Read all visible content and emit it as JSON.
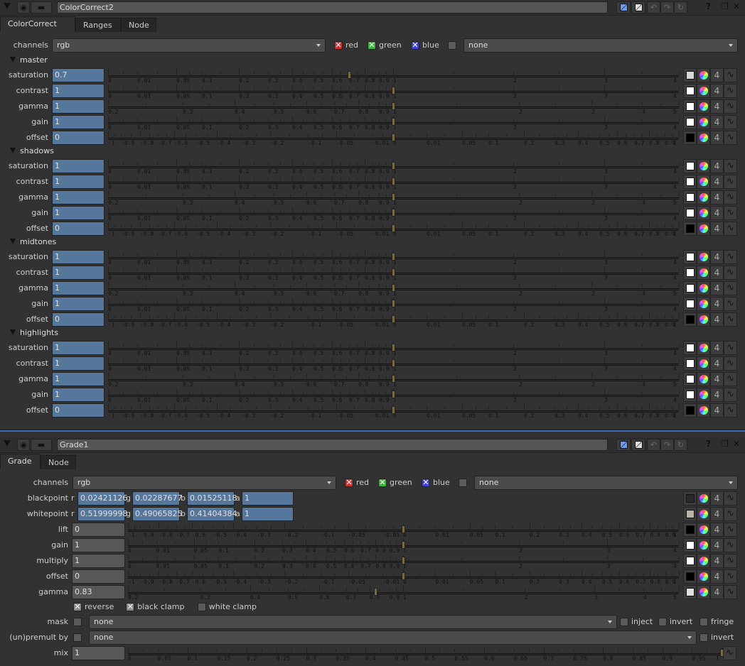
{
  "panel1": {
    "title": "ColorCorrect2",
    "tabs": [
      "ColorCorrect",
      "Ranges",
      "Node"
    ],
    "channels_label": "channels",
    "channels_value": "rgb",
    "red": "red",
    "green": "green",
    "blue": "blue",
    "extra_channel": "none",
    "sections": [
      {
        "name": "master",
        "rows": [
          {
            "label": "saturation",
            "value": "0.7",
            "scale": "lin4",
            "swatch": "#d8d8d8"
          },
          {
            "label": "contrast",
            "value": "1",
            "scale": "lin4",
            "swatch": "#ffffff"
          },
          {
            "label": "gamma",
            "value": "1",
            "scale": "gamma",
            "swatch": "#ffffff"
          },
          {
            "label": "gain",
            "value": "1",
            "scale": "lin4",
            "swatch": "#ffffff"
          },
          {
            "label": "offset",
            "value": "0",
            "scale": "offset",
            "swatch": "#000000"
          }
        ]
      },
      {
        "name": "shadows",
        "rows": [
          {
            "label": "saturation",
            "value": "1",
            "scale": "lin4",
            "swatch": "#ffffff"
          },
          {
            "label": "contrast",
            "value": "1",
            "scale": "lin4",
            "swatch": "#ffffff"
          },
          {
            "label": "gamma",
            "value": "1",
            "scale": "gamma",
            "swatch": "#ffffff"
          },
          {
            "label": "gain",
            "value": "1",
            "scale": "lin4",
            "swatch": "#ffffff"
          },
          {
            "label": "offset",
            "value": "0",
            "scale": "offset",
            "swatch": "#000000"
          }
        ]
      },
      {
        "name": "midtones",
        "rows": [
          {
            "label": "saturation",
            "value": "1",
            "scale": "lin4",
            "swatch": "#ffffff"
          },
          {
            "label": "contrast",
            "value": "1",
            "scale": "lin4",
            "swatch": "#ffffff"
          },
          {
            "label": "gamma",
            "value": "1",
            "scale": "gamma",
            "swatch": "#ffffff"
          },
          {
            "label": "gain",
            "value": "1",
            "scale": "lin4",
            "swatch": "#ffffff"
          },
          {
            "label": "offset",
            "value": "0",
            "scale": "offset",
            "swatch": "#000000"
          }
        ]
      },
      {
        "name": "highlights",
        "rows": [
          {
            "label": "saturation",
            "value": "1",
            "scale": "lin4",
            "swatch": "#ffffff"
          },
          {
            "label": "contrast",
            "value": "1",
            "scale": "lin4",
            "swatch": "#ffffff"
          },
          {
            "label": "gamma",
            "value": "1",
            "scale": "gamma",
            "swatch": "#ffffff"
          },
          {
            "label": "gain",
            "value": "1",
            "scale": "lin4",
            "swatch": "#ffffff"
          },
          {
            "label": "offset",
            "value": "0",
            "scale": "offset",
            "swatch": "#000000"
          }
        ]
      }
    ]
  },
  "panel2": {
    "title": "Grade1",
    "tabs": [
      "Grade",
      "Node"
    ],
    "channels_label": "channels",
    "channels_value": "rgb",
    "red": "red",
    "green": "green",
    "blue": "blue",
    "extra_channel": "none",
    "blackpoint": {
      "label": "blackpoint",
      "r": "0.02421126",
      "g": "0.02287677",
      "b": "0.01525118",
      "a": "1",
      "swatch": "#2a2a26"
    },
    "whitepoint": {
      "label": "whitepoint",
      "r": "0.51999998",
      "g": "0.49065825",
      "b": "0.41404384",
      "a": "1",
      "swatch": "#b9b2a6"
    },
    "comp_labels": [
      "r",
      "g",
      "b",
      "a"
    ],
    "rows": [
      {
        "label": "lift",
        "value": "0",
        "scale": "offset",
        "swatch": "#000000"
      },
      {
        "label": "gain",
        "value": "1",
        "scale": "lin4",
        "swatch": "#ffffff"
      },
      {
        "label": "multiply",
        "value": "1",
        "scale": "lin4",
        "swatch": "#ffffff"
      },
      {
        "label": "offset",
        "value": "0",
        "scale": "offset",
        "swatch": "#000000"
      },
      {
        "label": "gamma",
        "value": "0.83",
        "scale": "gamma",
        "swatch": "#e0e0e0"
      }
    ],
    "checks": [
      {
        "label": "reverse",
        "checked": true
      },
      {
        "label": "black clamp",
        "checked": true
      },
      {
        "label": "white clamp",
        "checked": false
      }
    ],
    "mask": {
      "label": "mask",
      "value": "none",
      "inject": "inject",
      "invert": "invert",
      "fringe": "fringe"
    },
    "premult": {
      "label": "(un)premult by",
      "value": "none",
      "invert": "invert"
    },
    "mix": {
      "label": "mix",
      "value": "1",
      "scale": "mix"
    }
  },
  "scales": {
    "lin4": [
      "0",
      "0.01",
      "0.05",
      "0.1",
      "0.2",
      "0.3",
      "0.4",
      "0.5",
      "0.6",
      "0.7",
      "0.8",
      "0.9",
      "1",
      "2",
      "3",
      "4"
    ],
    "gamma": [
      "0.2",
      "0.3",
      "0.4",
      "0.5",
      "0.6",
      "0.7",
      "0.8",
      "0.9",
      "1",
      "2",
      "3",
      "4",
      "5"
    ],
    "offset": [
      "-1",
      "-0.9",
      "-0.8",
      "-0.7",
      "-0.6",
      "-0.5",
      "-0.4",
      "-0.3",
      "-0.2",
      "-0.1",
      "-0.05",
      "-0.01",
      "0",
      "0.01",
      "0.05",
      "0.1",
      "0.2",
      "0.3",
      "0.4",
      "0.5",
      "0.6",
      "0.7",
      "0.8",
      "0.9",
      "1"
    ],
    "mix": [
      "0",
      "0.05",
      "0.1",
      "0.15",
      "0.2",
      "0.25",
      "0.3",
      "0.35",
      "0.4",
      "0.45",
      "0.5",
      "0.55",
      "0.6",
      "0.65",
      "0.7",
      "0.75",
      "0.8",
      "0.85",
      "0.9",
      "0.95",
      "1"
    ]
  },
  "swatch_button_value": "4",
  "colors": {
    "accent": "#3d6fb8",
    "input_blue": "#56779c",
    "red": "#c83232",
    "green": "#3cb43c",
    "blue": "#3c3cc8"
  }
}
